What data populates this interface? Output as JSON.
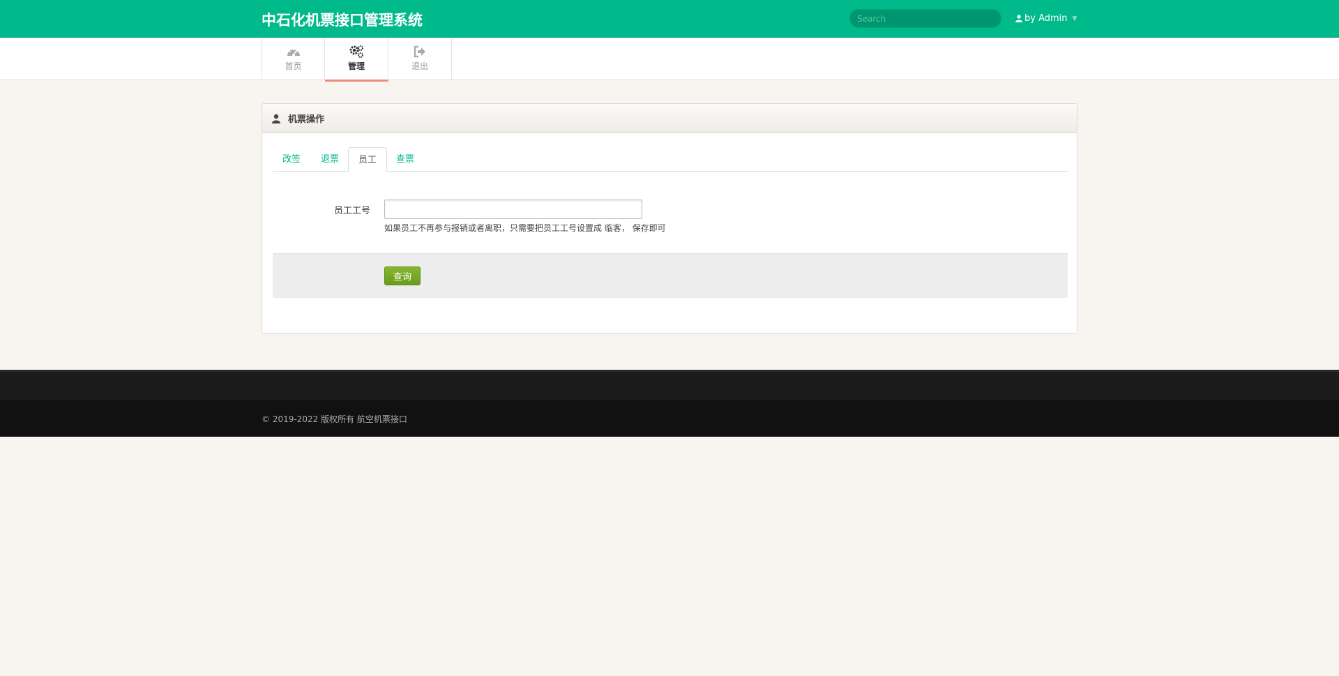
{
  "header": {
    "brand": "中石化机票接口管理系统",
    "search_placeholder": "Search",
    "user_label": "by Admin"
  },
  "nav": {
    "items": [
      {
        "label": "首页",
        "icon": "dashboard-icon"
      },
      {
        "label": "管理",
        "icon": "gears-icon",
        "active": true
      },
      {
        "label": "退出",
        "icon": "sign-out-icon"
      }
    ]
  },
  "panel": {
    "title": "机票操作",
    "tabs": [
      {
        "label": "改签"
      },
      {
        "label": "退票"
      },
      {
        "label": "员工",
        "active": true
      },
      {
        "label": "查票"
      }
    ],
    "form": {
      "field_label": "员工工号",
      "field_value": "",
      "help_text": "如果员工不再参与报销或者离职，只需要把员工工号设置成 临客， 保存即可",
      "submit_label": "查询"
    }
  },
  "footer": {
    "copyright": "© 2019-2022 版权所有 航空机票接口"
  },
  "colors": {
    "primary": "#00ba8b",
    "active_tab_underline": "#f08a78",
    "button": "#74a624"
  }
}
